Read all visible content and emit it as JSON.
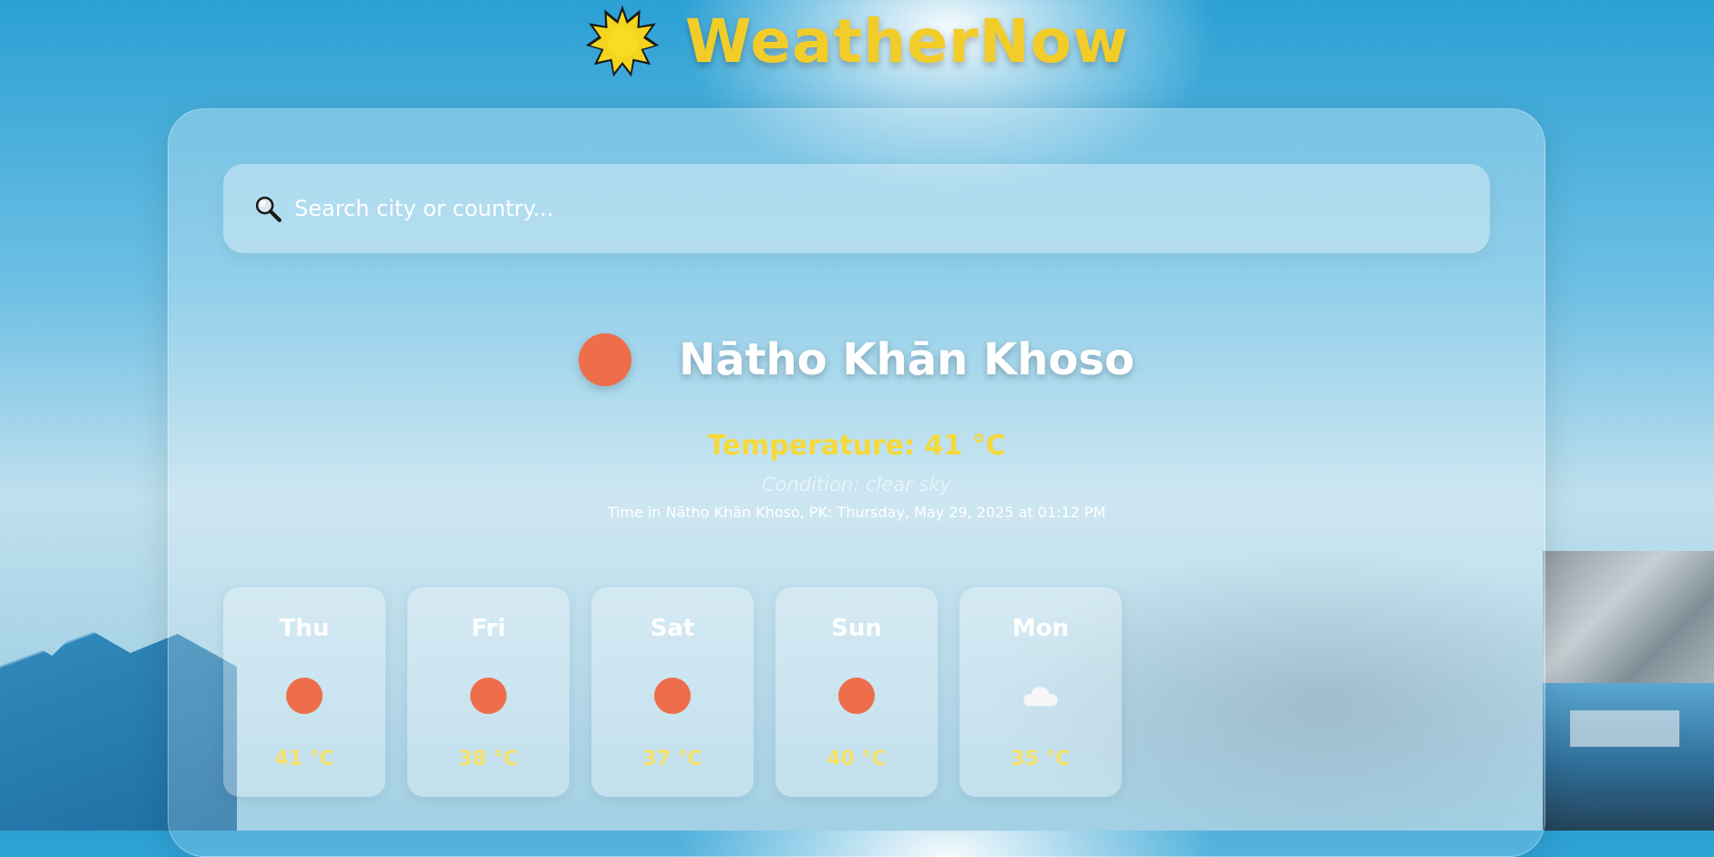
{
  "app": {
    "title": "WeatherNow",
    "logo_icon": "sun-icon"
  },
  "search": {
    "placeholder": "Search city or country...",
    "value": "",
    "icon": "search-icon"
  },
  "current": {
    "icon": "sun-icon",
    "city": "Nāthο Khān Khoso",
    "temperature": "Temperature: 41 °C",
    "condition": "Condition: clear sky",
    "local_time": "Time in Nātho Khān Khoso, PK: Thursday, May 29, 2025 at 01:12 PM"
  },
  "forecast": [
    {
      "day": "Thu",
      "icon": "sun-icon",
      "temp": "41 °C"
    },
    {
      "day": "Fri",
      "icon": "sun-icon",
      "temp": "38 °C"
    },
    {
      "day": "Sat",
      "icon": "sun-icon",
      "temp": "37 °C"
    },
    {
      "day": "Sun",
      "icon": "sun-icon",
      "temp": "40 °C"
    },
    {
      "day": "Mon",
      "icon": "cloud-icon",
      "temp": "35 °C"
    }
  ],
  "colors": {
    "title": "#f2cd2a",
    "sun": "#ee6e4c",
    "temperature": "#f5d93a",
    "forecast_temp": "#f6e26a"
  }
}
